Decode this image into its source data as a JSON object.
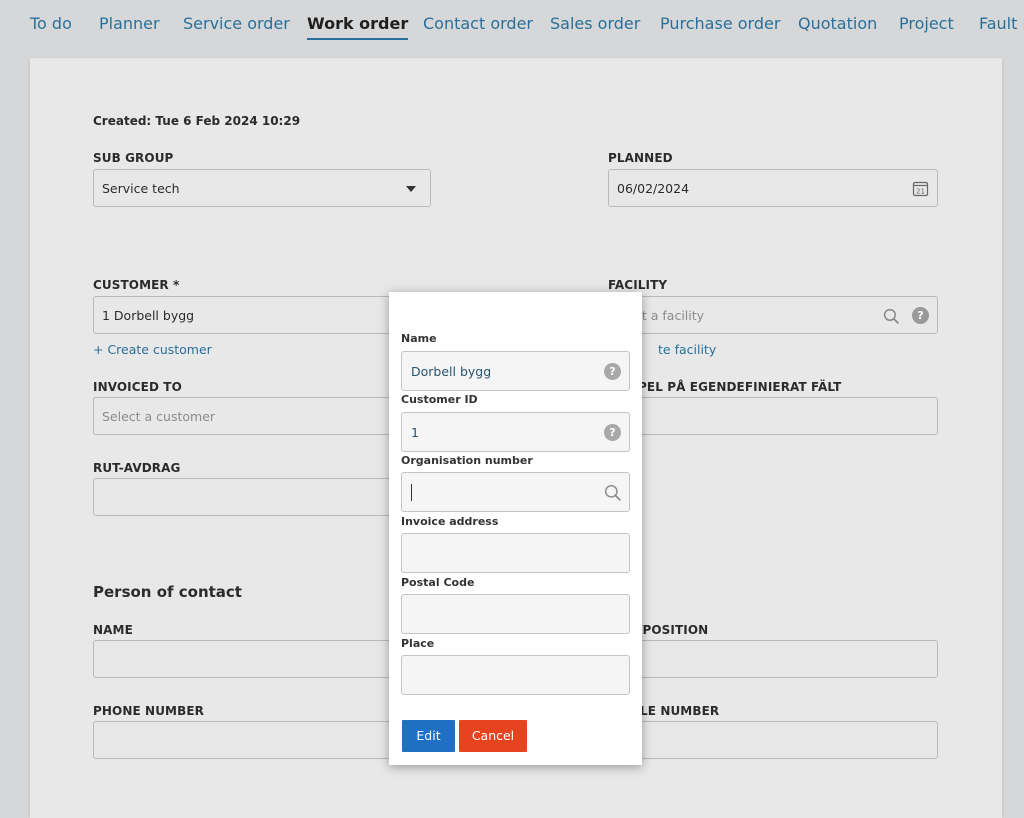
{
  "nav": {
    "tabs": [
      {
        "label": "To do"
      },
      {
        "label": "Planner"
      },
      {
        "label": "Service order"
      },
      {
        "label": "Work order",
        "active": true
      },
      {
        "label": "Contact order"
      },
      {
        "label": "Sales order"
      },
      {
        "label": "Purchase order"
      },
      {
        "label": "Quotation"
      },
      {
        "label": "Project"
      },
      {
        "label": "Fault r"
      }
    ]
  },
  "form": {
    "created": "Created: Tue 6 Feb 2024 10:29",
    "sub_group": {
      "label": "SUB GROUP",
      "value": "Service tech"
    },
    "planned": {
      "label": "PLANNED",
      "value": "06/02/2024",
      "calendar_day": "21"
    },
    "customer": {
      "label": "CUSTOMER *",
      "value": "1 Dorbell bygg",
      "create_link": "+ Create customer"
    },
    "facility": {
      "label": "FACILITY",
      "placeholder_visible": "ct a facility",
      "create_link_visible": "te facility"
    },
    "invoiced_to": {
      "label": "INVOICED TO",
      "placeholder": "Select a customer"
    },
    "custom_field_label_visible": "PEL PÅ EGENDEFINIERAT FÄLT",
    "rut_avdrag": {
      "label": "RUT-AVDRAG"
    },
    "person_of_contact": {
      "title": "Person of contact",
      "name_label": "NAME",
      "position_label_visible": "/POSITION",
      "phone_label": "PHONE NUMBER",
      "mobile_label_visible": "LE NUMBER"
    }
  },
  "modal": {
    "name": {
      "label": "Name",
      "value": "Dorbell bygg"
    },
    "customer_id": {
      "label": "Customer ID",
      "value": "1"
    },
    "organisation_number": {
      "label": "Organisation number",
      "value": ""
    },
    "invoice_address": {
      "label": "Invoice address",
      "value": ""
    },
    "postal_code": {
      "label": "Postal Code",
      "value": ""
    },
    "place": {
      "label": "Place",
      "value": ""
    },
    "edit_label": "Edit",
    "cancel_label": "Cancel",
    "help_glyph": "?"
  },
  "colors": {
    "link": "#2a6f99",
    "edit_button": "#1f6fc5",
    "cancel_button": "#e8431f"
  }
}
